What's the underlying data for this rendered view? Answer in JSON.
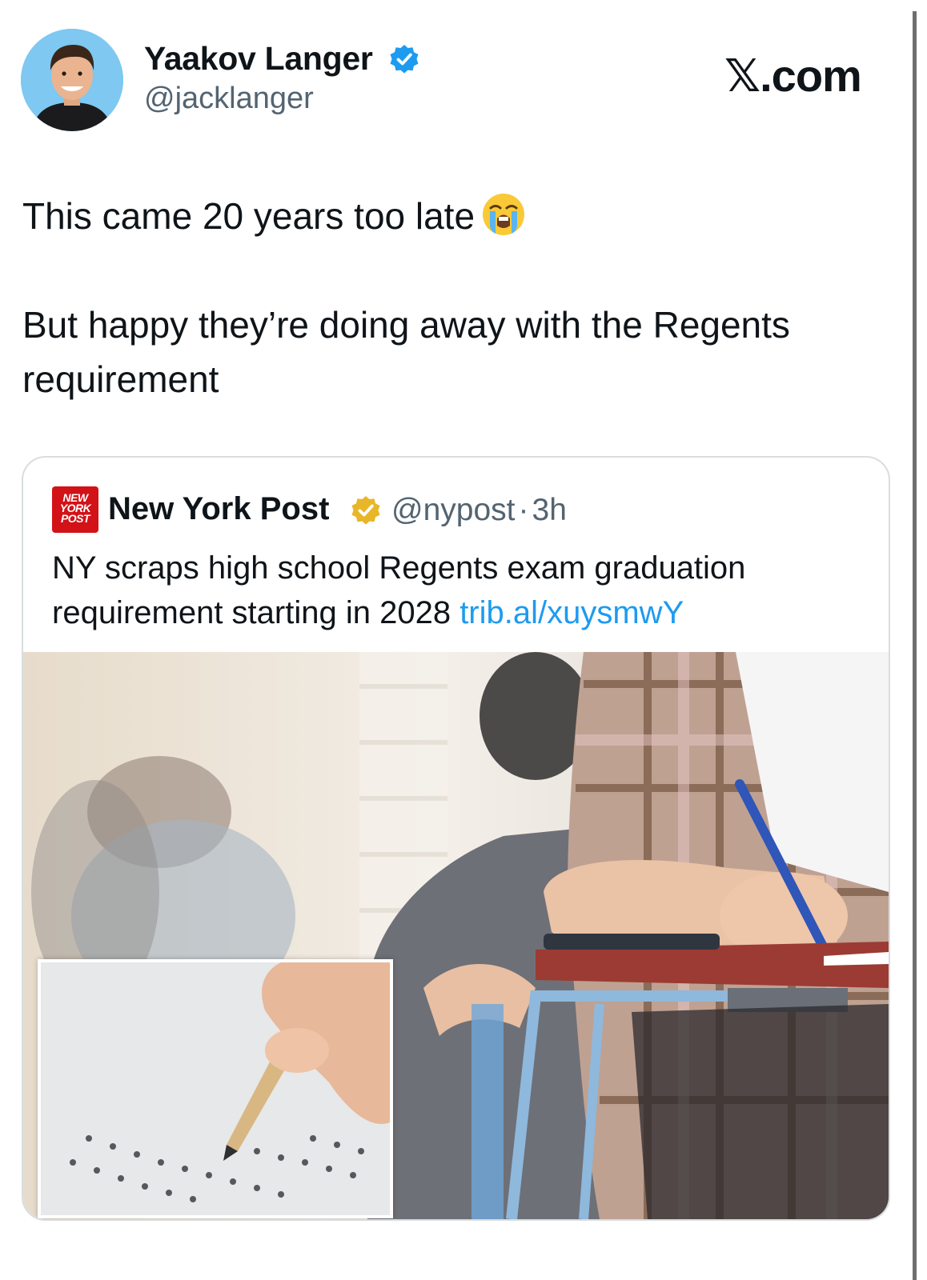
{
  "author": {
    "display_name": "Yaakov Langer",
    "handle": "@jacklanger",
    "avatar_icon": "profile-photo",
    "verified_color": "#1d9bf0"
  },
  "brand": {
    "label": "𝕏.com"
  },
  "tweet": {
    "line1": "This came 20 years too late",
    "emoji": "loudly-crying-face",
    "line2": "But happy they’re doing away with the Regents requirement"
  },
  "quote": {
    "logo_lines": [
      "NEW",
      "YORK",
      "POST"
    ],
    "display_name": "New York Post",
    "verified_color": "#e8b629",
    "handle": "@nypost",
    "separator": "·",
    "time": "3h",
    "text": "NY scraps high school Regents exam graduation requirement starting in 2028 ",
    "link": "trib.al/xuysmwY"
  },
  "colors": {
    "link": "#1d9bf0",
    "secondary_text": "#536471",
    "logo_red": "#d21217"
  }
}
